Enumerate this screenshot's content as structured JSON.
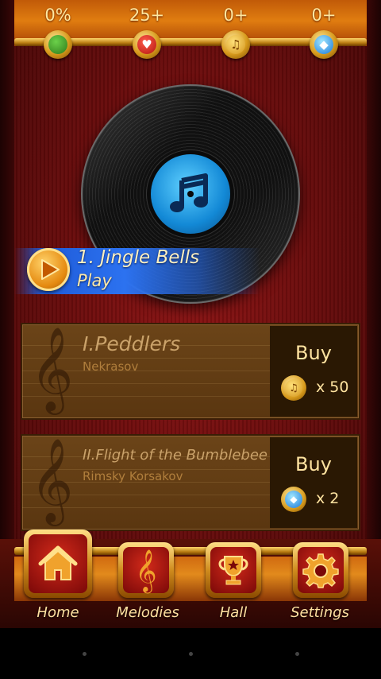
{
  "stats": [
    {
      "value": "0%",
      "icon": "progress-icon"
    },
    {
      "value": "25+",
      "icon": "heart-icon"
    },
    {
      "value": "0+",
      "icon": "note-coin-icon"
    },
    {
      "value": "0+",
      "icon": "gem-icon"
    }
  ],
  "current_track": {
    "title": "1. Jingle Bells",
    "action": "Play"
  },
  "melodies": [
    {
      "title": "I.Peddlers",
      "author": "Nekrasov",
      "buy_label": "Buy",
      "price": "x 50",
      "currency_icon": "note-coin-icon"
    },
    {
      "title": "II.Flight of the Bumblebee",
      "author": "Rimsky Korsakov",
      "buy_label": "Buy",
      "price": "x 2",
      "currency_icon": "gem-icon"
    }
  ],
  "nav": [
    {
      "label": "Home",
      "icon": "home-icon",
      "active": true
    },
    {
      "label": "Melodies",
      "icon": "treble-clef-icon",
      "active": false
    },
    {
      "label": "Hall",
      "icon": "trophy-icon",
      "active": false
    },
    {
      "label": "Settings",
      "icon": "gear-icon",
      "active": false
    }
  ],
  "colors": {
    "background": "#6a0c0c",
    "accent_gold": "#e07d10",
    "play_banner": "#2c72f0",
    "card": "#5a3610"
  }
}
